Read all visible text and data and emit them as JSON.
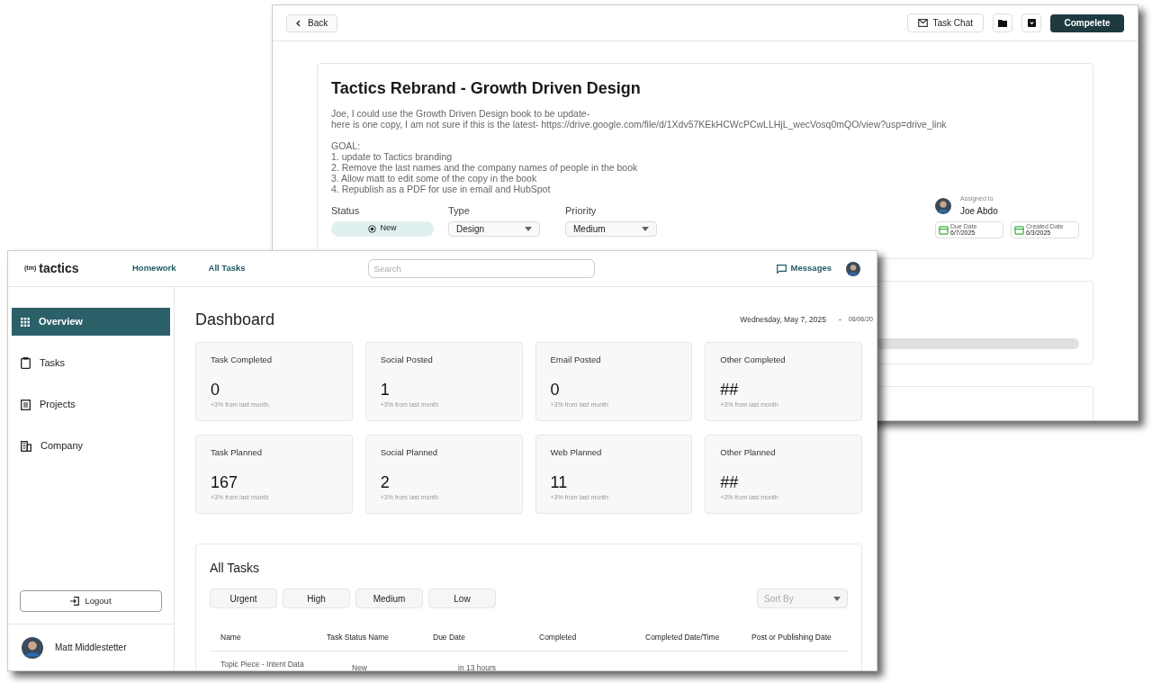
{
  "task_window": {
    "back_button": "Back",
    "task_chat_button": "Task Chat",
    "complete_button": "Compelete",
    "task": {
      "title": "Tactics Rebrand - Growth Driven Design",
      "paragraphs": [
        [
          "Joe, I could use the Growth Driven Design book to be update-",
          "here is one copy, I am not sure if this is the latest- https://drive.google.com/file/d/1Xdv57KEkHCWcPCwLLHjL_wecVosq0mQO/view?usp=drive_link"
        ],
        [
          "GOAL:",
          "1. update to Tactics branding",
          "2. Remove the last names and the company names of people in the book",
          "3. Allow matt to edit some of the copy in the book",
          "4. Republish as a PDF for use in email and HubSpot"
        ]
      ],
      "fields": [
        {
          "label": "Status",
          "value": "New",
          "kind": "badge"
        },
        {
          "label": "Type",
          "value": "Design",
          "kind": "select"
        },
        {
          "label": "Priority",
          "value": "Medium",
          "kind": "select"
        }
      ],
      "assigned_label": "Assigned to",
      "assignee": "Joe Abdo",
      "dates": [
        {
          "label": "Due Date",
          "value": "6/7/2025"
        },
        {
          "label": "Created Date",
          "value": "6/3/2025"
        }
      ]
    }
  },
  "dashboard_window": {
    "logo_mark": "(tm)",
    "logo": "tactics",
    "nav": [
      {
        "label": "Homework"
      },
      {
        "label": "All Tasks"
      }
    ],
    "search": {
      "placeholder": "Search"
    },
    "messages": "Messages",
    "sidebar": {
      "items": [
        {
          "label": "Overview",
          "selected": true
        },
        {
          "label": "Tasks",
          "selected": false
        },
        {
          "label": "Projects",
          "selected": false
        },
        {
          "label": "Company",
          "selected": false
        }
      ],
      "logout": "Logout",
      "user": "Matt Middlestetter"
    },
    "title": "Dashboard",
    "date_start": "Wednesday, May 7, 2025",
    "date_separator": "-",
    "date_end": "06/06/20",
    "stats": [
      {
        "label": "Task Completed",
        "value": "0",
        "note": "+3% from last month."
      },
      {
        "label": "Social Posted",
        "value": "1",
        "note": "+3% from last month"
      },
      {
        "label": "Email Posted",
        "value": "0",
        "note": "+3% from last month"
      },
      {
        "label": "Other Completed",
        "value": "##",
        "note": "+3% from last month"
      },
      {
        "label": "Task Planned",
        "value": "167",
        "note": "+3% from last month"
      },
      {
        "label": "Social Planned",
        "value": "2",
        "note": "+3% from last month"
      },
      {
        "label": "Web Planned",
        "value": "11",
        "note": "+3% from last month"
      },
      {
        "label": "Other Planned",
        "value": "##",
        "note": "+3% from last month"
      }
    ],
    "all_tasks": {
      "title": "All Tasks",
      "filters": [
        "Urgent",
        "High",
        "Medium",
        "Low"
      ],
      "sort": {
        "placeholder": "Sort By"
      },
      "columns": [
        "Name",
        "Task Status Name",
        "Due Date",
        "Completed",
        "Completed Date/Time",
        "Post or Publishing Date"
      ],
      "rows": [
        {
          "cells": [
            "Topic Piece - Intent Data",
            "New",
            "in 13 hours"
          ]
        }
      ]
    }
  }
}
